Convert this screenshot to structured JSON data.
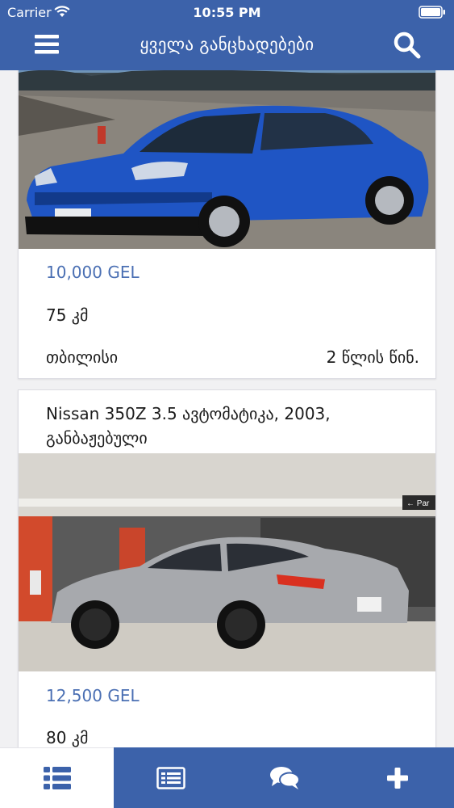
{
  "status_bar": {
    "carrier": "Carrier",
    "time": "10:55 PM"
  },
  "header": {
    "title": "ყველა განცხადებები",
    "menu_icon": "hamburger-menu-icon",
    "search_icon": "search-icon"
  },
  "listings": [
    {
      "title": "",
      "price": "10,000 GEL",
      "mileage": "75  კმ",
      "city": "თბილისი",
      "posted": "2 წლის წინ.",
      "photo": "blue-sedan-car"
    },
    {
      "title": "Nissan 350Z 3.5 ავტომატიკა, 2003, განბაჟებული",
      "price": "12,500 GEL",
      "mileage": "80  კმ",
      "photo": "silver-sports-coupe-in-parking-garage"
    }
  ],
  "tabbar": {
    "active_index": 0,
    "tabs": [
      {
        "icon": "list-icon"
      },
      {
        "icon": "ad-card-icon"
      },
      {
        "icon": "chat-bubbles-icon"
      },
      {
        "icon": "plus-icon"
      }
    ]
  },
  "colors": {
    "header": "#3c62aa",
    "price": "#4a6fb3",
    "tab_active_icon": "#3c62aa",
    "tab_icon": "#ffffff"
  }
}
